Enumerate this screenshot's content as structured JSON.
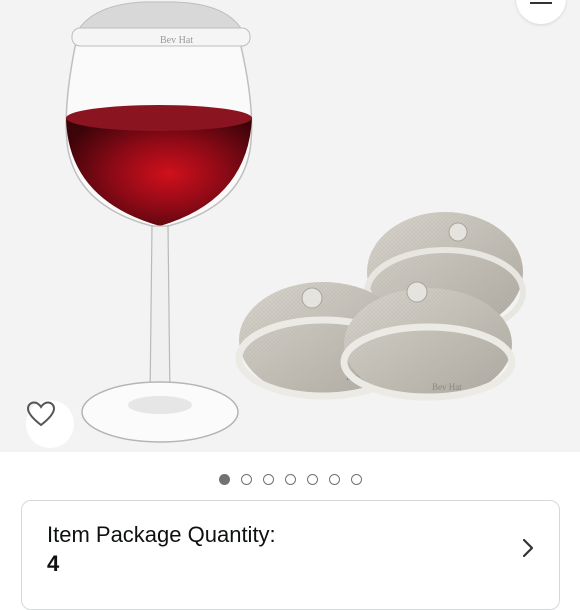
{
  "product_image": {
    "brand_mark": "Bev Hat",
    "carousel_total": 7,
    "carousel_active_index": 0
  },
  "icons": {
    "menu": "menu-icon",
    "wishlist": "heart-icon",
    "chevron": "chevron-right-icon"
  },
  "options": {
    "quantity_label": "Item Package Quantity:",
    "quantity_value": "4"
  },
  "colors": {
    "wine": "#6b0a14",
    "page_background": "#f3f3f3",
    "card_border": "#d5d9d9"
  }
}
